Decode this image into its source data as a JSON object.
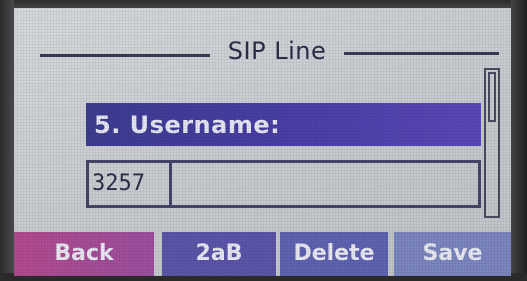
{
  "screen": {
    "title": "SIP Line"
  },
  "field": {
    "label": "5. Username:",
    "value": "3257"
  },
  "softkeys": {
    "back": "Back",
    "input_mode": "2aB",
    "delete": "Delete",
    "save": "Save"
  },
  "colors": {
    "lcd_background": "#c9cdd1",
    "header_bar": "#4a3fa8",
    "text_dark": "#2c2c48",
    "softkey_back": "#b34a8e",
    "softkey_other": "#5a55a8"
  }
}
